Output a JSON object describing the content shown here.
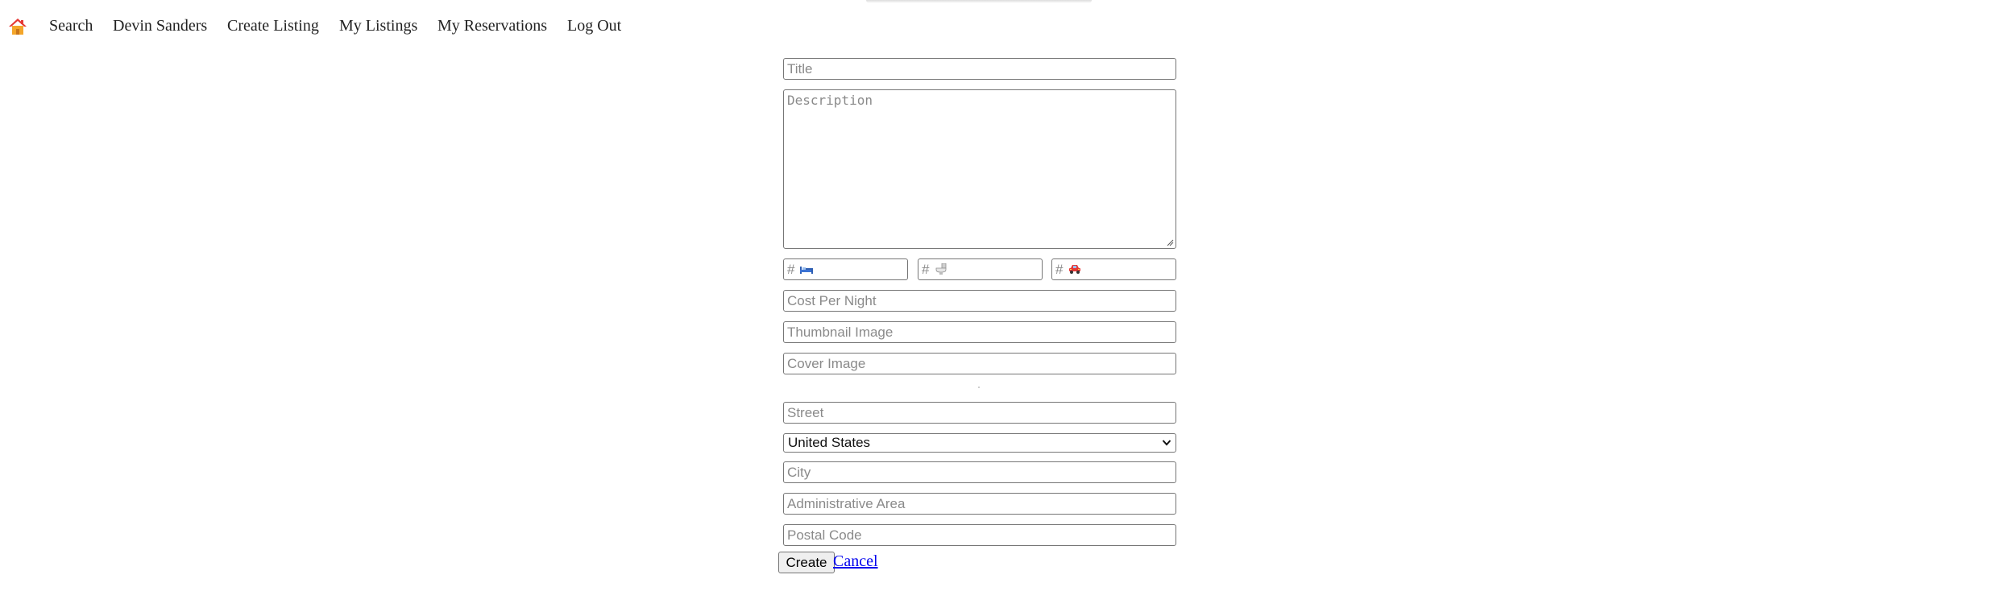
{
  "nav": {
    "home_icon": "home-icon",
    "items": [
      {
        "label": "Search"
      },
      {
        "label": "Devin Sanders"
      },
      {
        "label": "Create Listing"
      },
      {
        "label": "My Listings"
      },
      {
        "label": "My Reservations"
      },
      {
        "label": "Log Out"
      }
    ]
  },
  "form": {
    "title": {
      "placeholder": "Title",
      "value": ""
    },
    "description": {
      "placeholder": "Description",
      "value": ""
    },
    "counts": [
      {
        "prefix": "#",
        "icon": "bed-icon"
      },
      {
        "prefix": "#",
        "icon": "toilet-icon"
      },
      {
        "prefix": "#",
        "icon": "car-icon"
      }
    ],
    "cost_per_night": {
      "placeholder": "Cost Per Night"
    },
    "thumbnail_image": {
      "placeholder": "Thumbnail Image"
    },
    "cover_image": {
      "placeholder": "Cover Image"
    },
    "street": {
      "placeholder": "Street"
    },
    "country": {
      "selected": "United States"
    },
    "city": {
      "placeholder": "City"
    },
    "administrative_area": {
      "placeholder": "Administrative Area"
    },
    "postal_code": {
      "placeholder": "Postal Code"
    },
    "create_label": "Create",
    "cancel_label": "Cancel"
  },
  "colors": {
    "link": "#0000ee",
    "home_roof": "#e53935",
    "home_wall": "#f4a62a"
  }
}
